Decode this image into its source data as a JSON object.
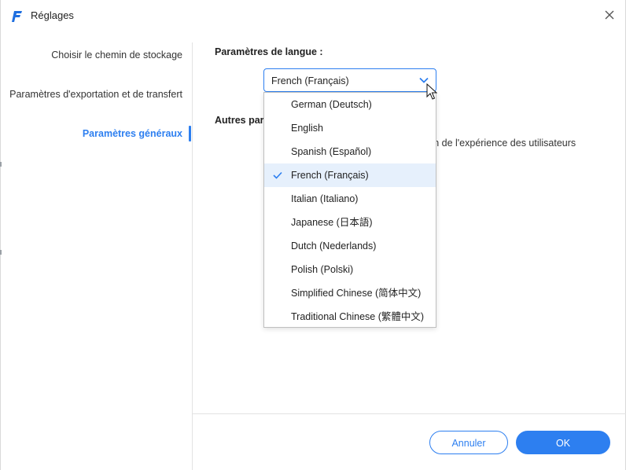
{
  "window": {
    "title": "Réglages",
    "accent_color": "#2d7ff0",
    "logo_color": "#1f6fe0"
  },
  "sidebar": {
    "items": [
      {
        "label": "Choisir le chemin de stockage",
        "active": false
      },
      {
        "label": "Paramètres d'exportation et de transfert",
        "active": false
      },
      {
        "label": "Paramètres généraux",
        "active": true
      }
    ]
  },
  "main": {
    "language_section_title": "Paramètres de langue :",
    "language_select": {
      "value": "French (Français)",
      "options": [
        {
          "label": "German (Deutsch)",
          "selected": false
        },
        {
          "label": "English",
          "selected": false
        },
        {
          "label": "Spanish (Español)",
          "selected": false
        },
        {
          "label": "French (Français)",
          "selected": true
        },
        {
          "label": "Italian (Italiano)",
          "selected": false
        },
        {
          "label": "Japanese (日本語)",
          "selected": false
        },
        {
          "label": "Dutch (Nederlands)",
          "selected": false
        },
        {
          "label": "Polish (Polski)",
          "selected": false
        },
        {
          "label": "Simplified Chinese (简体中文)",
          "selected": false
        },
        {
          "label": "Traditional Chinese (繁體中文)",
          "selected": false
        }
      ]
    },
    "other_section_title_visible": "Autres para",
    "other_text_visible": "tion de l'expérience des utilisateurs"
  },
  "footer": {
    "cancel_label": "Annuler",
    "ok_label": "OK"
  },
  "icons": {
    "logo": "app-logo-icon",
    "close": "close-icon",
    "chevron": "chevron-down-icon",
    "check": "check-icon",
    "cursor": "mouse-cursor-icon"
  }
}
